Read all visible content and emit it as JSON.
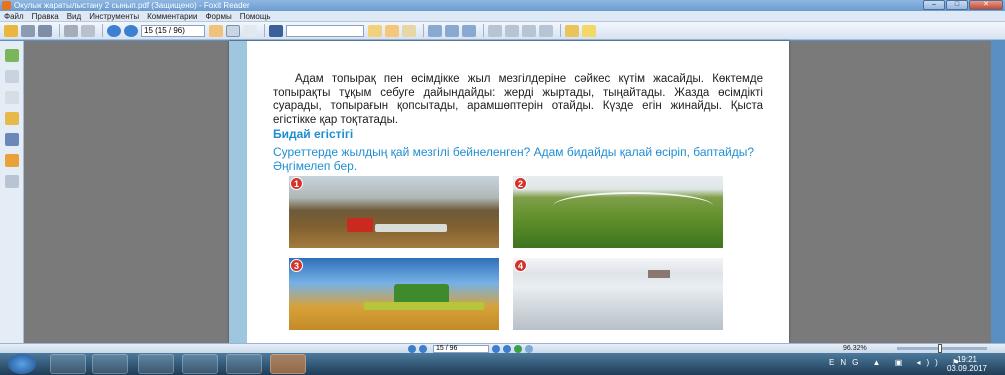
{
  "window": {
    "title": "Окулык жаратылыстану 2 сынып.pdf (Защищено) - Foxit Reader",
    "min": "–",
    "max": "□",
    "close": "✕"
  },
  "menu": {
    "items": [
      "Файл",
      "Правка",
      "Вид",
      "Инструменты",
      "Комментарии",
      "Формы",
      "Помощь"
    ]
  },
  "toolbar": {
    "page_value": "15 (15 / 96)"
  },
  "document": {
    "paragraph": "Адам топырақ пен өсімдікке жыл мезгілдеріне сәйкес күтім жасайды. Көктемде топырақты тұқым себуге дайындайды: жерді жыртады, тыңайтады. Жазда өсімдікті суарады, топырағын қопсытады, арамшөптерін отайды. Күзде егін жинайды. Қыста егістікке қар тоқтатады.",
    "heading": "Бидай егістігі",
    "question": "Суреттерде жылдың қай мезгілі бейнеленген? Адам бидайды қалай өсіріп, баптайды? Әңгімелеп бер.",
    "photos": [
      {
        "number": "1",
        "scene": "tractor plowing field"
      },
      {
        "number": "2",
        "scene": "irrigation sprinkler"
      },
      {
        "number": "3",
        "scene": "combine harvester"
      },
      {
        "number": "4",
        "scene": "snowy field"
      }
    ]
  },
  "status": {
    "page_value": "15 / 96",
    "zoom": "96.32%"
  },
  "taskbar": {
    "tray": "ENG ▲ ▣ ◂)) ⚑",
    "time": "19:21",
    "date": "03.09.2017"
  }
}
